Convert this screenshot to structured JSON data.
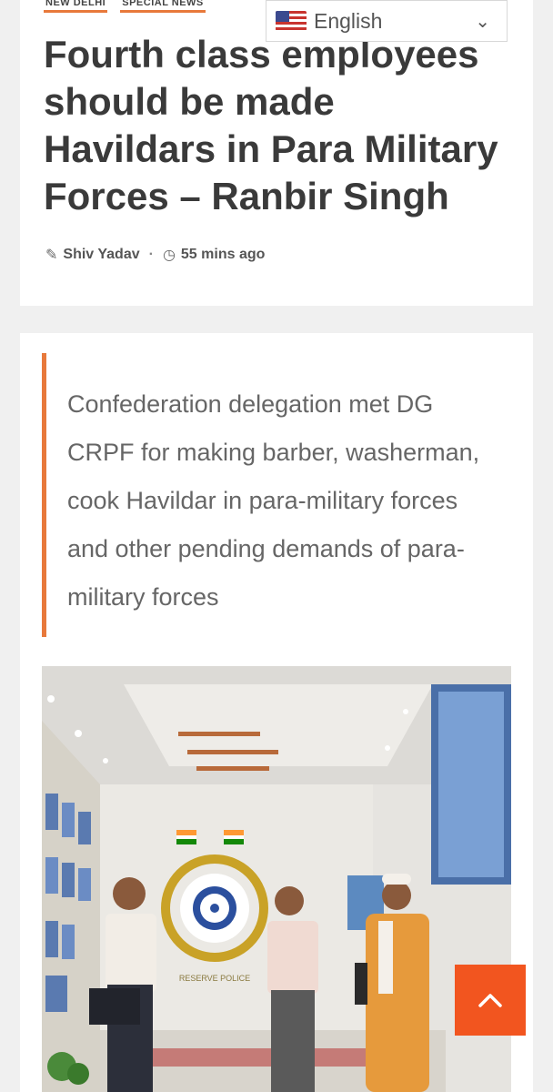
{
  "categories": [
    "NEW DELHI",
    "SPECIAL NEWS"
  ],
  "language": {
    "selected": "English"
  },
  "article": {
    "title": "Fourth class employees should be made Havildars in Para Military Forces – Ranbir Singh",
    "author": "Shiv Yadav",
    "time": "55 mins ago",
    "quote": "Confederation delegation met DG CRPF for making barber, washerman, cook Havildar in para-military forces and other pending demands of para-military forces"
  },
  "photo": {
    "emblem_text": "RESERVE POLICE"
  },
  "icons": {
    "author": "edit-icon",
    "time": "clock-icon",
    "scroll": "chevron-up-icon",
    "lang": "us-flag-icon"
  },
  "colors": {
    "accent": "#e8793b",
    "scroll_button": "#f2551f",
    "title": "#3a3a3a"
  }
}
